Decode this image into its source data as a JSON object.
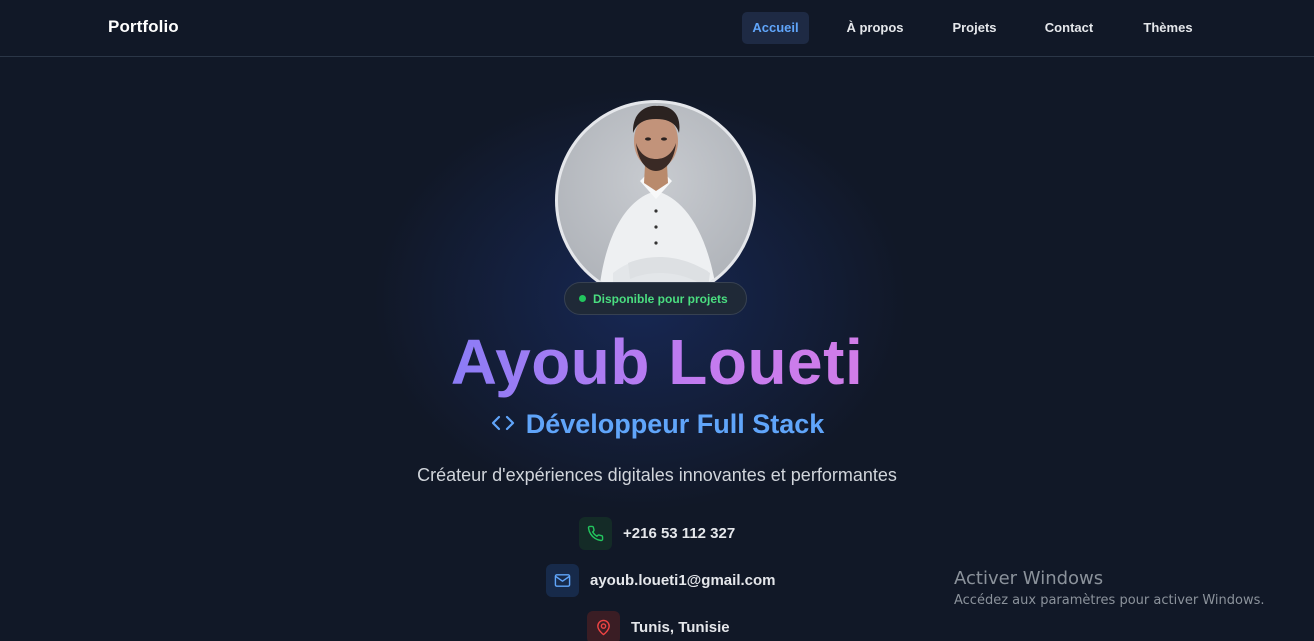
{
  "nav": {
    "brand": "Portfolio",
    "links": [
      {
        "label": "Accueil",
        "active": true
      },
      {
        "label": "À propos",
        "active": false
      },
      {
        "label": "Projets",
        "active": false
      },
      {
        "label": "Contact",
        "active": false
      },
      {
        "label": "Thèmes",
        "active": false
      }
    ]
  },
  "hero": {
    "status_badge": "Disponible pour projets",
    "name": "Ayoub Loueti",
    "role": "Développeur Full Stack",
    "tagline": "Créateur d'expériences digitales innovantes et performantes",
    "contacts": [
      {
        "icon": "phone-icon",
        "text": "+216 53 112 327"
      },
      {
        "icon": "mail-icon",
        "text": "ayoub.loueti1@gmail.com"
      },
      {
        "icon": "map-pin-icon",
        "text": "Tunis, Tunisie"
      }
    ]
  },
  "colors": {
    "background": "#111827",
    "accent_blue": "#60a5fa",
    "name_gradient_start": "#8b7cf6",
    "name_gradient_end": "#d17de8",
    "status_green": "#22c55e"
  },
  "windows_watermark": {
    "title": "Activer Windows",
    "subtitle": "Accédez aux paramètres pour activer Windows."
  }
}
